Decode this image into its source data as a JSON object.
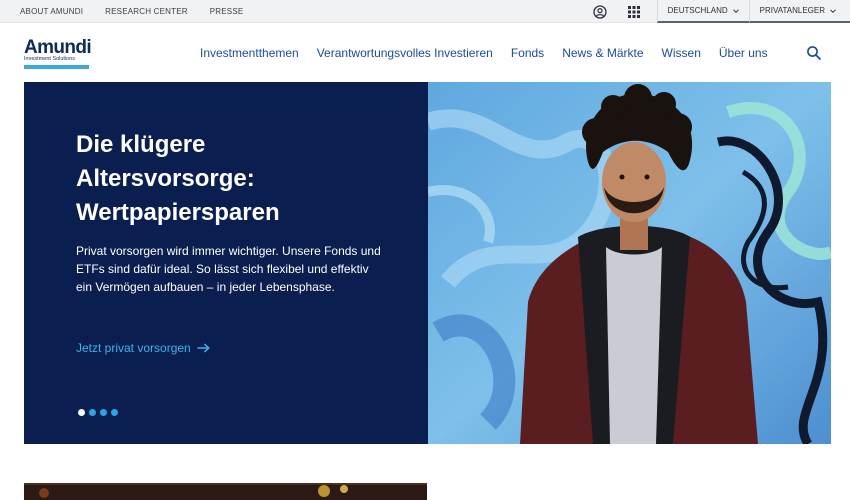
{
  "topbar": {
    "links": [
      "ABOUT AMUNDI",
      "RESEARCH CENTER",
      "PRESSE"
    ],
    "account_icon": "user-circle-icon",
    "apps_icon": "grid-icon",
    "country": "DEUTSCHLAND",
    "audience": "PRIVATANLEGER"
  },
  "header": {
    "logo_word": "Amundi",
    "logo_tagline": "Investment Solutions",
    "nav": [
      "Investmentthemen",
      "Verantwortungsvolles Investieren",
      "Fonds",
      "News & Märkte",
      "Wissen",
      "Über uns"
    ],
    "search_icon": "search-icon"
  },
  "hero": {
    "title": "Die klügere Altersvorsorge: Wertpapiersparen",
    "text": "Privat vorsorgen wird immer wichtiger. Unsere Fonds und ETFs sind dafür ideal. So lässt sich flexibel und effektiv ein Vermögen aufbauen – in jeder Lebensphase.",
    "cta": "Jetzt privat vorsorgen",
    "slides": 4,
    "active_slide": 1
  },
  "colors": {
    "panel": "#0a1e4f",
    "accent": "#3ab4ee",
    "nav_link": "#1d4aa0",
    "brand_bar": "#3aa6dc"
  }
}
